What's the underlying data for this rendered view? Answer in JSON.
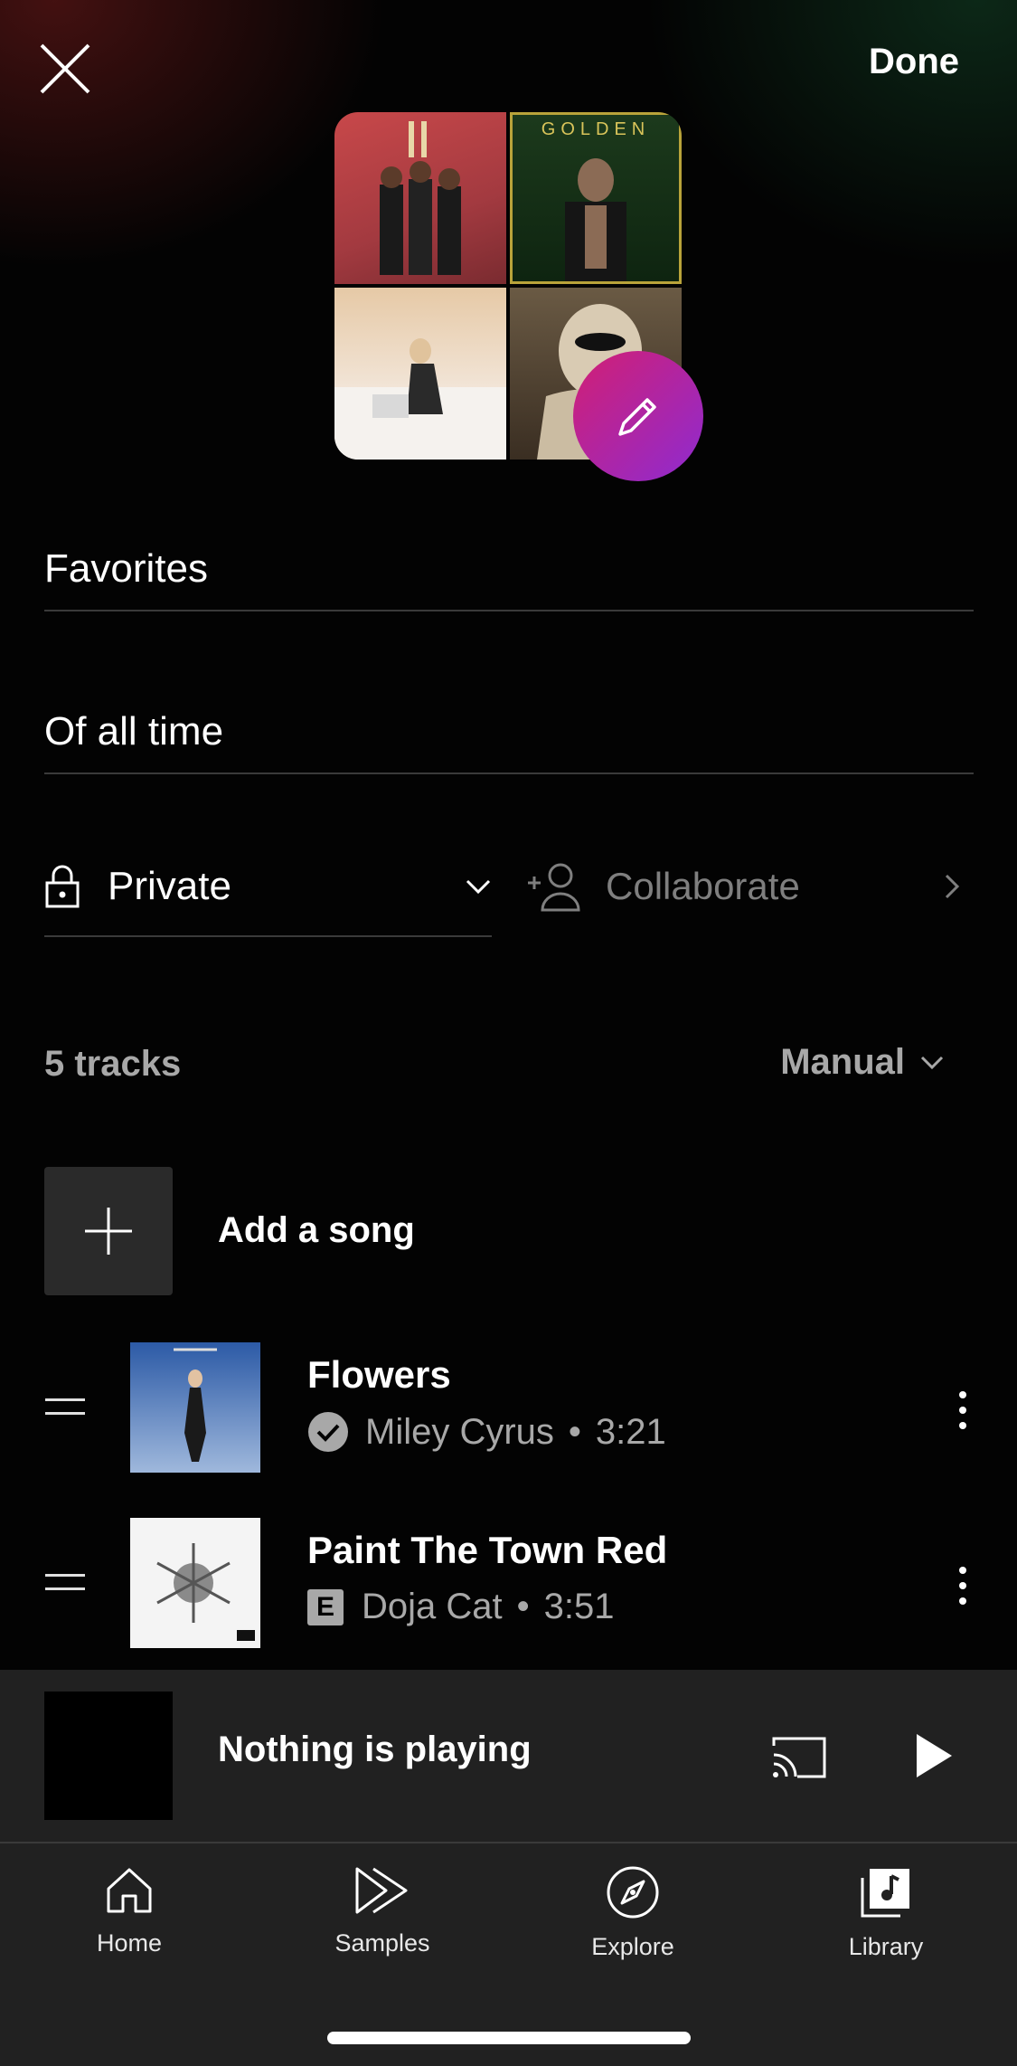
{
  "header": {
    "done_label": "Done"
  },
  "playlist": {
    "title": "Favorites",
    "description": "Of all time",
    "privacy": "Private",
    "collaborate_label": "Collaborate"
  },
  "tracks_section": {
    "count_label": "5 tracks",
    "sort_label": "Manual",
    "add_label": "Add a song"
  },
  "tracks": [
    {
      "title": "Flowers",
      "artist": "Miley Cyrus",
      "duration": "3:21",
      "badge": "check-icon"
    },
    {
      "title": "Paint The Town Red",
      "artist": "Doja Cat",
      "duration": "3:51",
      "badge": "E"
    }
  ],
  "mini_player": {
    "title": "Nothing is playing"
  },
  "nav": {
    "home": "Home",
    "samples": "Samples",
    "explore": "Explore",
    "library": "Library"
  },
  "colors": {
    "accent_start": "#d21f73",
    "accent_end": "#8e2bd1",
    "background": "#030303",
    "surface": "#212121"
  }
}
